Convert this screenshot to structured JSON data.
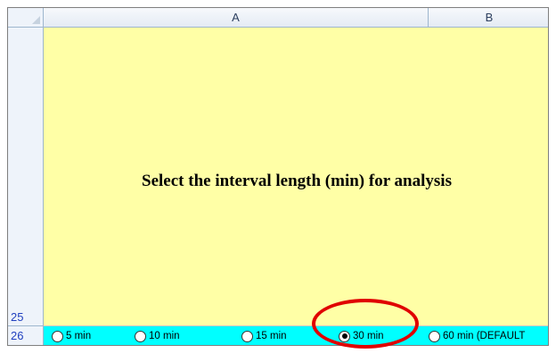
{
  "sheet": {
    "columns": [
      "A",
      "B"
    ],
    "rows": [
      "25",
      "26"
    ]
  },
  "cells": {
    "prompt_text": "Select the interval length (min) for analysis"
  },
  "interval_options": {
    "options": [
      "5 min",
      "10 min",
      "15 min",
      "30 min",
      "60 min (DEFAULT"
    ],
    "selected": "30 min"
  },
  "colors": {
    "prompt_cell_bg": "#ffffa6",
    "options_row_bg": "#00ffff",
    "highlight_ellipse": "#e00000"
  }
}
